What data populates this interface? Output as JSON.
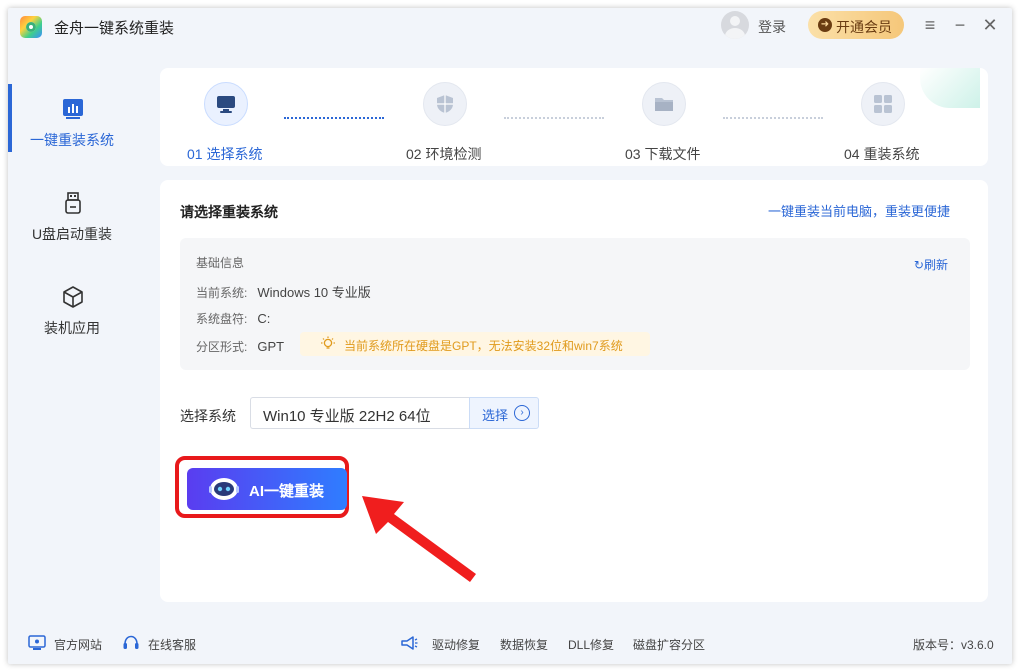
{
  "app": {
    "title": "金舟一键系统重装"
  },
  "header": {
    "login_label": "登录",
    "vip_label": "开通会员",
    "menu_icon": "menu-icon",
    "minimize_icon": "minimize-icon",
    "close_icon": "close-icon"
  },
  "sidebar": {
    "items": [
      {
        "label": "一键重装系统",
        "icon": "chart-icon",
        "active": true
      },
      {
        "label": "U盘启动重装",
        "icon": "usb-icon",
        "active": false
      },
      {
        "label": "装机应用",
        "icon": "cube-icon",
        "active": false
      }
    ]
  },
  "steps": [
    {
      "label": "01 选择系统",
      "icon": "monitor-icon",
      "active": true
    },
    {
      "label": "02 环境检测",
      "icon": "shield-icon",
      "active": false
    },
    {
      "label": "03 下载文件",
      "icon": "folder-icon",
      "active": false
    },
    {
      "label": "04 重装系统",
      "icon": "windows-icon",
      "active": false
    }
  ],
  "main": {
    "title": "请选择重装系统",
    "link": "一键重装当前电脑，重装更便捷",
    "info": {
      "heading": "基础信息",
      "refresh": "刷新",
      "current_system_label": "当前系统:",
      "current_system_value": "Windows 10 专业版",
      "system_drive_label": "系统盘符:",
      "system_drive_value": "C:",
      "partition_label": "分区形式:",
      "partition_value": "GPT",
      "warning": "当前系统所在硬盘是GPT，无法安装32位和win7系统"
    },
    "select": {
      "label": "选择系统",
      "value": "Win10 专业版 22H2 64位",
      "button": "选择"
    },
    "ai_button": "AI一键重装"
  },
  "footer": {
    "website": "官方网站",
    "support": "在线客服",
    "driver_repair": "驱动修复",
    "data_recovery": "数据恢复",
    "dll_repair": "DLL修复",
    "disk_extend": "磁盘扩容分区",
    "version": "版本号：v3.6.0"
  },
  "colors": {
    "accent": "#2b67d6",
    "warning": "#e09a1c",
    "highlight": "#e8191b"
  }
}
